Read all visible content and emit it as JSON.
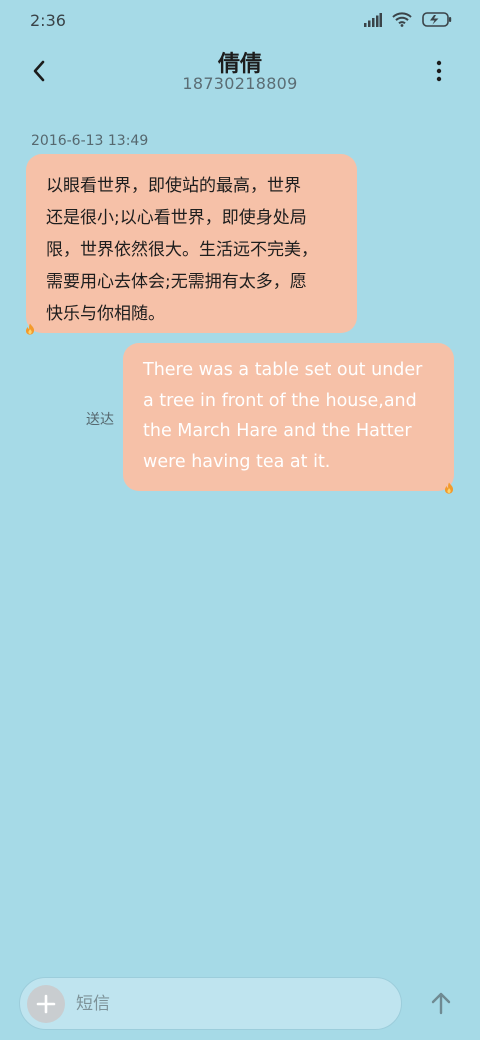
{
  "status_bar": {
    "time": "2:36",
    "icons": [
      "signal-icon",
      "wifi-icon",
      "battery-charging-icon"
    ]
  },
  "header": {
    "back_icon": "chevron-left-icon",
    "title": "倩倩",
    "phone_number": "18730218809",
    "more_icon": "more-vertical-icon"
  },
  "conversation": {
    "timestamp": "2016-6-13 13:49",
    "messages": [
      {
        "direction": "incoming",
        "text": "以眼看世界，即使站的最高，世界还是很小;以心看世界，即使身处局限，世界依然很大。生活远不完美，需要用心去体会;无需拥有太多，愿快乐与你相随。",
        "lines": [
          "以眼看世界，即使站的最高，世界",
          "还是很小;以心看世界，即使身处局",
          "限，世界依然很大。生活远不完美，",
          "需要用心去体会;无需拥有太多，愿",
          "快乐与你相随。"
        ],
        "icon": "flame-icon"
      },
      {
        "direction": "outgoing",
        "status": "送达",
        "text": "There was a table set out under a tree in front of the house,and the March Hare and the Hatter were having tea at it.",
        "lines": [
          "There was a table set out under",
          "a tree in front of the house,and",
          "the March Hare and the Hatter",
          "were having tea at it."
        ],
        "icon": "flame-icon"
      }
    ]
  },
  "composer": {
    "add_icon": "plus-icon",
    "placeholder": "短信",
    "send_icon": "arrow-up-icon"
  },
  "colors": {
    "background": "#a6dae7",
    "bubble": "#f6c1a8",
    "outgoing_text": "#ffffff",
    "incoming_text": "#1e1e1e"
  }
}
